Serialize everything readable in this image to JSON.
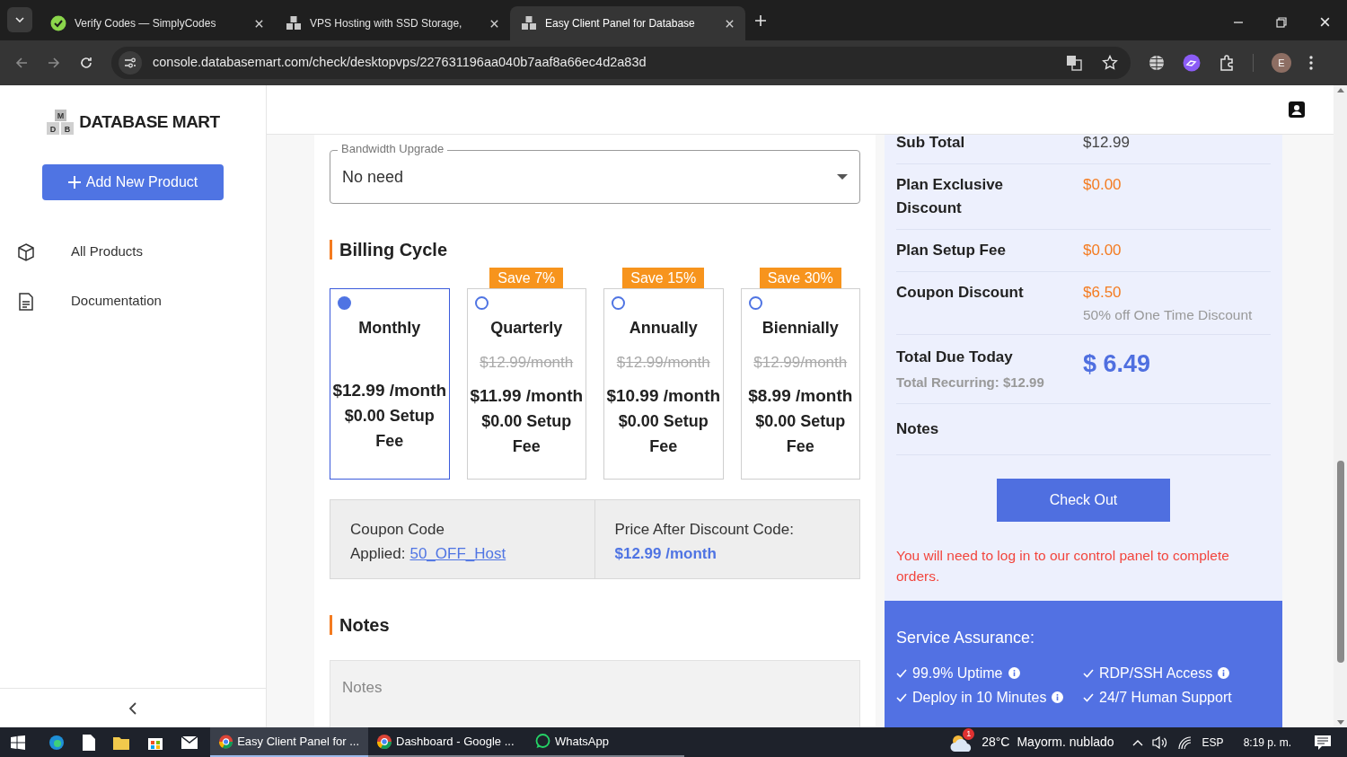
{
  "browser": {
    "tabs": [
      {
        "title": "Verify Codes — SimplyCodes",
        "selected": false
      },
      {
        "title": "VPS Hosting with SSD Storage,",
        "selected": false
      },
      {
        "title": "Easy Client Panel for Database",
        "selected": true
      }
    ],
    "url": "console.databasemart.com/check/desktopvps/227631196aa040b7aaf8a66ec4d2a83d",
    "profile_initial": "E"
  },
  "sidebar": {
    "logo_letters": [
      "M",
      "D",
      "B"
    ],
    "logo_text": "DATABASE MART",
    "add_button": "Add New Product",
    "items": [
      {
        "label": "All Products"
      },
      {
        "label": "Documentation"
      }
    ]
  },
  "form": {
    "bandwidth": {
      "label": "Bandwidth Upgrade",
      "value": "No need"
    },
    "billing_heading": "Billing Cycle",
    "cycles": [
      {
        "name": "Monthly",
        "price": "$12.99 /month",
        "setup": "$0.00 Setup Fee",
        "selected": true
      },
      {
        "name": "Quarterly",
        "badge": "Save 7%",
        "old_price": "$12.99/month",
        "price": "$11.99 /month",
        "setup": "$0.00 Setup Fee",
        "selected": false
      },
      {
        "name": "Annually",
        "badge": "Save 15%",
        "old_price": "$12.99/month",
        "price": "$10.99 /month",
        "setup": "$0.00 Setup Fee",
        "selected": false
      },
      {
        "name": "Biennially",
        "badge": "Save 30%",
        "old_price": "$12.99/month",
        "price": "$8.99 /month",
        "setup": "$0.00 Setup Fee",
        "selected": false
      }
    ],
    "coupon": {
      "label": "Coupon Code",
      "applied_label": "Applied:",
      "code": "50_OFF_Host",
      "after_label": "Price After Discount Code:",
      "after_price": "$12.99 /month"
    },
    "notes_heading": "Notes",
    "notes_placeholder": "Notes"
  },
  "summary": {
    "rows": [
      {
        "label": "Sub Total",
        "value": "$12.99",
        "kind": "plain"
      },
      {
        "label": "Plan Exclusive Discount",
        "value": "$0.00",
        "kind": "discount"
      },
      {
        "label": "Plan Setup Fee",
        "value": "$0.00",
        "kind": "discount"
      },
      {
        "label": "Coupon Discount",
        "value": "$6.50",
        "kind": "discount",
        "note": "50% off One Time Discount"
      }
    ],
    "total": {
      "label": "Total Due Today",
      "recurring": "Total Recurring: $12.99",
      "amount": "$ 6.49"
    },
    "notes_label": "Notes",
    "checkout": "Check Out",
    "login_note": "You will need to log in to our control panel to complete orders.",
    "assurance": {
      "title": "Service Assurance:",
      "items": [
        {
          "text": "99.9% Uptime",
          "info": true
        },
        {
          "text": "RDP/SSH Access",
          "info": true
        },
        {
          "text": "Deploy in 10 Minutes",
          "info": true
        },
        {
          "text": "24/7 Human Support",
          "info": false
        }
      ]
    }
  },
  "taskbar": {
    "apps": [
      {
        "label": "Easy Client Panel for ...",
        "selected": true
      },
      {
        "label": "Dashboard - Google ...",
        "selected": false
      },
      {
        "label": "WhatsApp",
        "selected": false
      }
    ],
    "weather_badge": "1",
    "temperature": "28°C",
    "weather": "Mayorm. nublado",
    "language": "ESP",
    "time": "8:19 p. m."
  }
}
